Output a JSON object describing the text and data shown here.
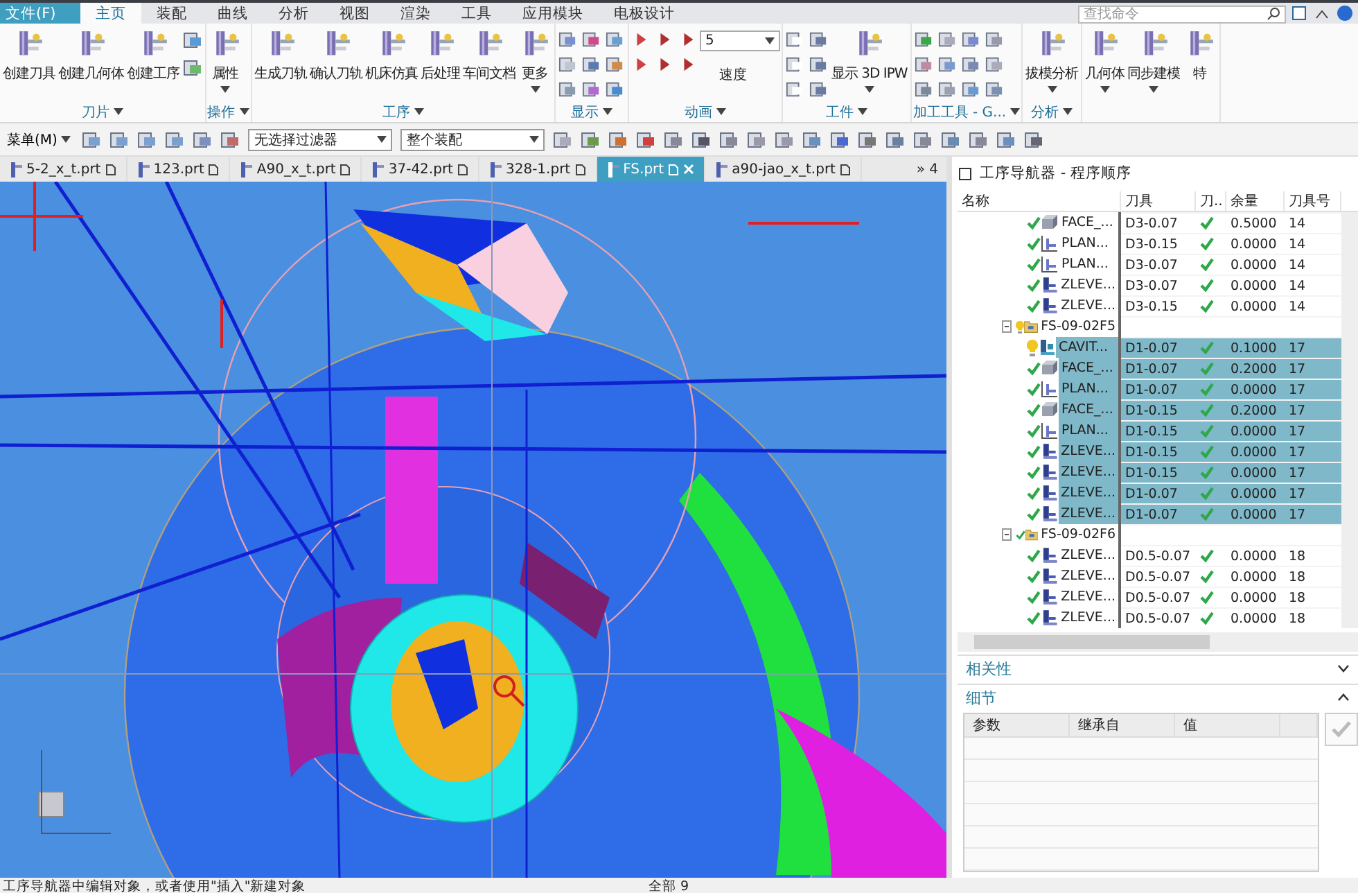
{
  "ribbon_tabs": [
    {
      "label": "文件(F)",
      "kind": "file",
      "selected": false
    },
    {
      "label": "主页",
      "kind": "tab",
      "selected": true
    },
    {
      "label": "装配",
      "kind": "tab",
      "selected": false
    },
    {
      "label": "曲线",
      "kind": "tab",
      "selected": false
    },
    {
      "label": "分析",
      "kind": "tab",
      "selected": false
    },
    {
      "label": "视图",
      "kind": "tab",
      "selected": false
    },
    {
      "label": "渲染",
      "kind": "tab",
      "selected": false
    },
    {
      "label": "工具",
      "kind": "tab",
      "selected": false
    },
    {
      "label": "应用模块",
      "kind": "tab",
      "selected": false
    },
    {
      "label": "电极设计",
      "kind": "tab",
      "selected": false
    }
  ],
  "command_search": {
    "placeholder": "查找命令"
  },
  "ribbon_groups": [
    {
      "kind": "commands_with_tools",
      "label": "刀片",
      "buttons": [
        {
          "label": "创建刀具",
          "menu": false
        },
        {
          "label": "创建几何体",
          "menu": false
        },
        {
          "label": "创建工序",
          "menu": false
        }
      ]
    },
    {
      "kind": "commands",
      "label": "操作",
      "buttons": [
        {
          "label": "属性",
          "menu": true
        }
      ]
    },
    {
      "kind": "commands",
      "label": "工序",
      "buttons": [
        {
          "label": "生成刀轨",
          "menu": false
        },
        {
          "label": "确认刀轨",
          "menu": false
        },
        {
          "label": "机床仿真",
          "menu": false
        },
        {
          "label": "后处理",
          "menu": false
        },
        {
          "label": "车间文档",
          "menu": false
        },
        {
          "label": "更多",
          "menu": true
        }
      ]
    },
    {
      "kind": "display",
      "label": "显示"
    },
    {
      "kind": "animation",
      "label": "动画",
      "speed_value": "5",
      "speed_label": "速度"
    },
    {
      "kind": "workpiece",
      "label": "工件",
      "buttons": [
        {
          "label": "显示 3D IPW",
          "menu": true
        }
      ]
    },
    {
      "kind": "tools",
      "label": "加工工具 - G..."
    },
    {
      "kind": "commands",
      "label": "分析",
      "buttons": [
        {
          "label": "拔模分析",
          "menu": true
        }
      ]
    },
    {
      "kind": "commands",
      "buttons": [
        {
          "label": "几何体",
          "menu": true
        },
        {
          "label": "同步建模",
          "menu": true
        },
        {
          "label": "特",
          "menu": false
        }
      ]
    }
  ],
  "toolbar": {
    "menu_label": "菜单(M)",
    "filter": "无选择过滤器",
    "scope": "整个装配"
  },
  "file_tabs": [
    {
      "label": "5-2_x_t.prt",
      "selected": false
    },
    {
      "label": "123.prt",
      "selected": false
    },
    {
      "label": "A90_x_t.prt",
      "selected": false
    },
    {
      "label": "37-42.prt",
      "selected": false
    },
    {
      "label": "328-1.prt",
      "selected": false
    },
    {
      "label": "FS.prt",
      "selected": true
    },
    {
      "label": "a90-jao_x_t.prt",
      "selected": false
    }
  ],
  "file_tabs_overflow": "» 4",
  "navigator": {
    "title": "工序导航器 - 程序顺序",
    "columns": [
      "名称",
      "刀具",
      "刀..",
      "余量",
      "刀具号"
    ],
    "rows": [
      {
        "kind": "face",
        "name": "FACE_...",
        "tool": "D3-0.07",
        "verified": true,
        "stock": "0.5000",
        "tool_number": "14",
        "needs_regeneration": false,
        "selected": false
      },
      {
        "kind": "planar",
        "name": "PLAN...",
        "tool": "D3-0.15",
        "verified": true,
        "stock": "0.0000",
        "tool_number": "14",
        "needs_regeneration": false,
        "selected": false
      },
      {
        "kind": "planar",
        "name": "PLAN...",
        "tool": "D3-0.07",
        "verified": true,
        "stock": "0.0000",
        "tool_number": "14",
        "needs_regeneration": false,
        "selected": false
      },
      {
        "kind": "zlevel",
        "name": "ZLEVE...",
        "tool": "D3-0.07",
        "verified": true,
        "stock": "0.0000",
        "tool_number": "14",
        "needs_regeneration": false,
        "selected": false
      },
      {
        "kind": "zlevel",
        "name": "ZLEVE...",
        "tool": "D3-0.15",
        "verified": true,
        "stock": "0.0000",
        "tool_number": "14",
        "needs_regeneration": false,
        "selected": false
      },
      {
        "kind": "group",
        "name": "FS-09-02F5",
        "needs_regeneration": true,
        "expanded": true,
        "selected": false,
        "children": [
          {
            "kind": "cavity",
            "name": "CAVIT...",
            "tool": "D1-0.07",
            "verified": true,
            "stock": "0.1000",
            "tool_number": "17",
            "needs_regeneration": true,
            "selected": true
          },
          {
            "kind": "face",
            "name": "FACE_...",
            "tool": "D1-0.07",
            "verified": true,
            "stock": "0.2000",
            "tool_number": "17",
            "needs_regeneration": false,
            "selected": true
          },
          {
            "kind": "planar",
            "name": "PLAN...",
            "tool": "D1-0.07",
            "verified": true,
            "stock": "0.0000",
            "tool_number": "17",
            "needs_regeneration": false,
            "selected": true
          },
          {
            "kind": "face",
            "name": "FACE_...",
            "tool": "D1-0.15",
            "verified": true,
            "stock": "0.2000",
            "tool_number": "17",
            "needs_regeneration": false,
            "selected": true
          },
          {
            "kind": "planar",
            "name": "PLAN...",
            "tool": "D1-0.15",
            "verified": true,
            "stock": "0.0000",
            "tool_number": "17",
            "needs_regeneration": false,
            "selected": true
          },
          {
            "kind": "zlevel",
            "name": "ZLEVE...",
            "tool": "D1-0.15",
            "verified": true,
            "stock": "0.0000",
            "tool_number": "17",
            "needs_regeneration": false,
            "selected": true
          },
          {
            "kind": "zlevel",
            "name": "ZLEVE...",
            "tool": "D1-0.15",
            "verified": true,
            "stock": "0.0000",
            "tool_number": "17",
            "needs_regeneration": false,
            "selected": true
          },
          {
            "kind": "zlevel",
            "name": "ZLEVE...",
            "tool": "D1-0.07",
            "verified": true,
            "stock": "0.0000",
            "tool_number": "17",
            "needs_regeneration": false,
            "selected": true
          },
          {
            "kind": "zlevel",
            "name": "ZLEVE...",
            "tool": "D1-0.07",
            "verified": true,
            "stock": "0.0000",
            "tool_number": "17",
            "needs_regeneration": false,
            "selected": true
          }
        ]
      },
      {
        "kind": "group",
        "name": "FS-09-02F6",
        "needs_regeneration": false,
        "expanded": true,
        "selected": false,
        "children": [
          {
            "kind": "zlevel",
            "name": "ZLEVE...",
            "tool": "D0.5-0.07",
            "verified": true,
            "stock": "0.0000",
            "tool_number": "18",
            "needs_regeneration": false,
            "selected": false
          },
          {
            "kind": "zlevel",
            "name": "ZLEVE...",
            "tool": "D0.5-0.07",
            "verified": true,
            "stock": "0.0000",
            "tool_number": "18",
            "needs_regeneration": false,
            "selected": false
          },
          {
            "kind": "zlevel",
            "name": "ZLEVE...",
            "tool": "D0.5-0.07",
            "verified": true,
            "stock": "0.0000",
            "tool_number": "18",
            "needs_regeneration": false,
            "selected": false
          },
          {
            "kind": "zlevel",
            "name": "ZLEVE...",
            "tool": "D0.5-0.07",
            "verified": true,
            "stock": "0.0000",
            "tool_number": "18",
            "needs_regeneration": false,
            "selected": false
          }
        ]
      }
    ]
  },
  "sections": [
    {
      "label": "相关性",
      "expanded": false
    },
    {
      "label": "细节",
      "expanded": true
    }
  ],
  "details": {
    "columns": [
      "参数",
      "继承自",
      "值"
    ],
    "apply_disabled": true
  },
  "status_bar": {
    "message": "工序导航器中编辑对象，或者使用\"插入\"新建对象",
    "count": "全部 9"
  }
}
